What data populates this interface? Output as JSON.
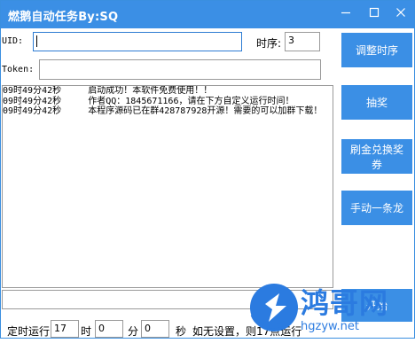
{
  "window": {
    "title": "燃鹅自动任务By:SQ"
  },
  "form": {
    "uid_label": "UID:",
    "uid_value": "",
    "order_label": "时序:",
    "order_value": "3",
    "token_label": "Token:",
    "token_value": ""
  },
  "log": {
    "lines": [
      "09时49分42秒     启动成功！本软件免费使用！！",
      "09时49分42秒     作者QQ：1845671166，请在下方自定义运行时间！",
      "09时49分42秒     本程序源码已在群428787928开源！需要的可以加群下载！"
    ]
  },
  "buttons": {
    "adjust_order": "调整时序",
    "lottery": "抽奖",
    "redeem_gold": "刷金兑换奖券",
    "manual_one": "手动一条龙"
  },
  "schedule": {
    "label_run": "定时运行",
    "hour_value": "17",
    "hour_label": "时",
    "minute_value": "0",
    "minute_label": "分",
    "second_value": "0",
    "second_label": "秒",
    "note": "如无设置，则17点运行"
  },
  "watermark": {
    "text": "鸿哥网",
    "url": "hgzyw.net",
    "partial": "开始"
  }
}
